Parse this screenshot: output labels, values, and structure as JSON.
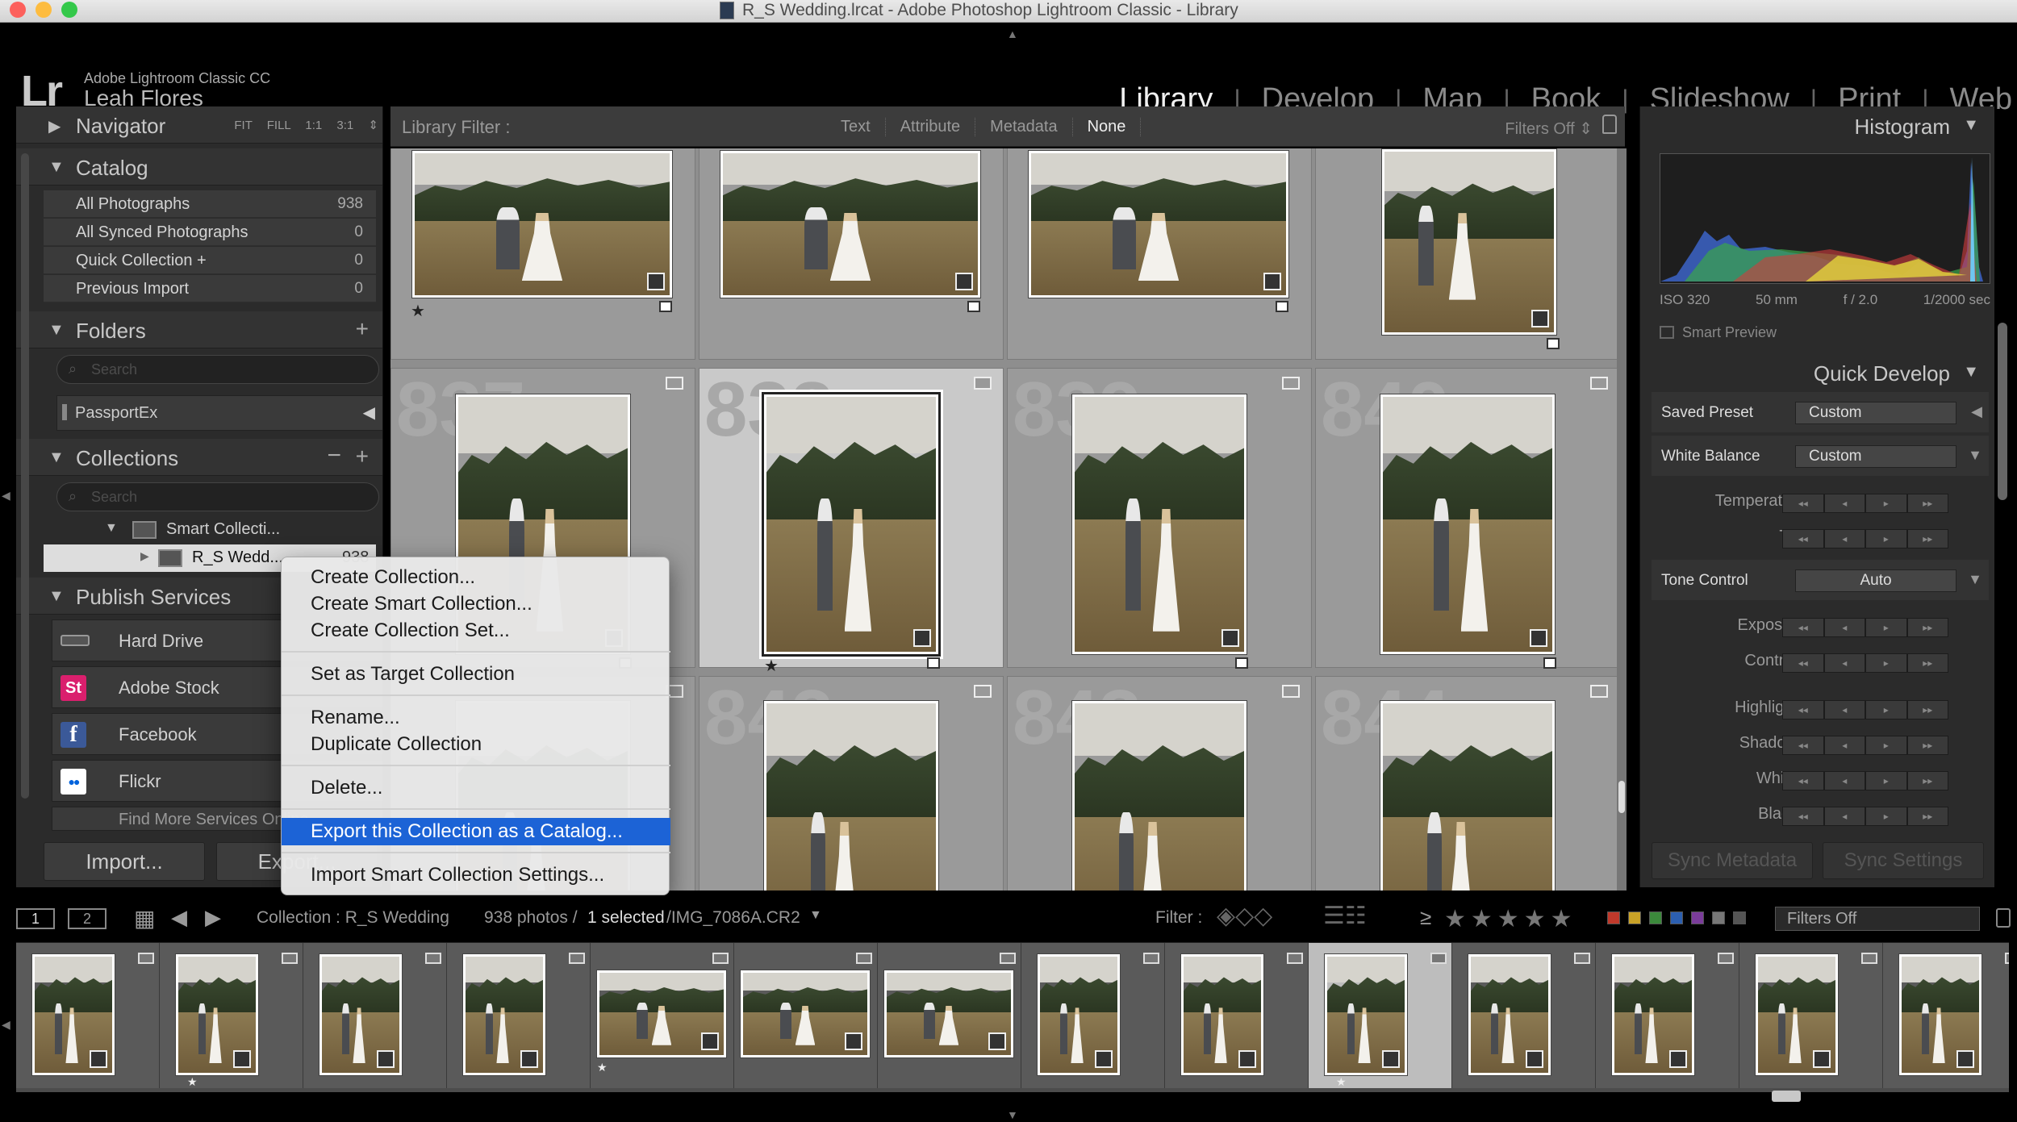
{
  "window": {
    "title": "R_S Wedding.lrcat - Adobe Photoshop Lightroom Classic - Library"
  },
  "identity": {
    "logo": "Lr",
    "product": "Adobe Lightroom Classic CC",
    "user": "Leah Flores"
  },
  "modules": [
    "Library",
    "Develop",
    "Map",
    "Book",
    "Slideshow",
    "Print",
    "Web"
  ],
  "left_panel": {
    "navigator": {
      "title": "Navigator",
      "options": "FIT FILL 1:1 3:1 ⇕"
    },
    "catalog": {
      "title": "Catalog",
      "items": [
        {
          "label": "All Photographs",
          "count": "938"
        },
        {
          "label": "All Synced Photographs",
          "count": "0"
        },
        {
          "label": "Quick Collection +",
          "count": "0"
        },
        {
          "label": "Previous Import",
          "count": "0"
        }
      ]
    },
    "folders": {
      "title": "Folders",
      "search_placeholder": "Search",
      "volume": "PassportEx"
    },
    "collections": {
      "title": "Collections",
      "search_placeholder": "Search",
      "set_label": "Smart Collecti...",
      "selected_label": "R_S Wedd...",
      "selected_count": "938"
    },
    "publish": {
      "title": "Publish Services",
      "services": [
        {
          "label": "Hard Drive",
          "icon": "hard-drive-icon",
          "color": "#555555",
          "glyph": ""
        },
        {
          "label": "Adobe Stock",
          "icon": "adobe-stock-icon",
          "color": "#da1f6d",
          "glyph": "St"
        },
        {
          "label": "Facebook",
          "icon": "facebook-icon",
          "color": "#3b5998",
          "glyph": "f"
        },
        {
          "label": "Flickr",
          "icon": "flickr-icon",
          "color": "#ffffff",
          "glyph": "●●"
        }
      ],
      "more": "Find More Services Online..."
    },
    "import_button": "Import...",
    "export_button": "Export..."
  },
  "library_filter": {
    "title": "Library Filter :",
    "options": [
      "Text",
      "Attribute",
      "Metadata",
      "None"
    ],
    "active": "None",
    "status": "Filters Off ⇕"
  },
  "grid": {
    "cells": [
      {
        "index": "",
        "star": "★",
        "selected": false,
        "orientation": "landscape"
      },
      {
        "index": "",
        "star": "",
        "selected": false,
        "orientation": "landscape"
      },
      {
        "index": "",
        "star": "",
        "selected": false,
        "orientation": "landscape"
      },
      {
        "index": "",
        "star": "",
        "selected": false,
        "orientation": "portrait"
      },
      {
        "index": "837",
        "star": "",
        "selected": false,
        "orientation": "portrait"
      },
      {
        "index": "838",
        "star": "★",
        "selected": true,
        "orientation": "portrait"
      },
      {
        "index": "839",
        "star": "",
        "selected": false,
        "orientation": "portrait"
      },
      {
        "index": "840",
        "star": "",
        "selected": false,
        "orientation": "portrait"
      },
      {
        "index": "841",
        "star": "",
        "selected": false,
        "orientation": "portrait"
      },
      {
        "index": "842",
        "star": "",
        "selected": false,
        "orientation": "portrait"
      },
      {
        "index": "843",
        "star": "",
        "selected": false,
        "orientation": "portrait"
      },
      {
        "index": "844",
        "star": "",
        "selected": false,
        "orientation": "portrait"
      }
    ]
  },
  "context_menu": {
    "items": [
      "Create Collection...",
      "Create Smart Collection...",
      "Create Collection Set...",
      "Set as Target Collection",
      "Rename...",
      "Duplicate Collection",
      "Delete...",
      "Export this Collection as a Catalog...",
      "Import Smart Collection Settings..."
    ],
    "highlighted": "Export this Collection as a Catalog..."
  },
  "right_panel": {
    "histogram": {
      "title": "Histogram",
      "iso": "ISO 320",
      "focal": "50 mm",
      "aperture": "f / 2.0",
      "shutter": "1/2000 sec",
      "smart_preview": "Smart Preview"
    },
    "quick_develop": {
      "title": "Quick Develop",
      "saved_preset_label": "Saved Preset",
      "saved_preset_value": "Custom",
      "white_balance_label": "White Balance",
      "white_balance_value": "Custom",
      "tone_control_label": "Tone Control",
      "auto_label": "Auto",
      "wb_adjustments": [
        "Temperature",
        "Tint"
      ],
      "tone_adjustments": [
        "Exposure",
        "Contrast"
      ],
      "tone_adjustments_2": [
        "Highlights",
        "Shadows",
        "Whites",
        "Blacks"
      ],
      "step_glyphs": [
        "◂◂",
        "◂",
        "▸",
        "▸▸"
      ]
    },
    "sync_metadata": "Sync Metadata",
    "sync_settings": "Sync Settings"
  },
  "filmstrip_bar": {
    "screen1": "1",
    "screen2": "2",
    "source": "Collection : R_S Wedding",
    "count": "938 photos /",
    "selected": "1 selected",
    "filename": "/IMG_7086A.CR2",
    "filter_label": "Filter :",
    "rating_op": "≥",
    "stars": "★★★★★",
    "filters_off": "Filters Off",
    "label_colors": [
      "#c0392b",
      "#c9a227",
      "#3c8a3c",
      "#2c5fb0",
      "#7a3c9a"
    ]
  },
  "filmstrip": {
    "thumbs": [
      {
        "orientation": "portrait",
        "star": "",
        "selected": false
      },
      {
        "orientation": "portrait",
        "star": "★",
        "selected": false
      },
      {
        "orientation": "portrait",
        "star": "",
        "selected": false
      },
      {
        "orientation": "portrait",
        "star": "",
        "selected": false
      },
      {
        "orientation": "landscape",
        "star": "★",
        "selected": false
      },
      {
        "orientation": "landscape",
        "star": "",
        "selected": false
      },
      {
        "orientation": "landscape",
        "star": "",
        "selected": false
      },
      {
        "orientation": "portrait",
        "star": "",
        "selected": false
      },
      {
        "orientation": "portrait",
        "star": "",
        "selected": false
      },
      {
        "orientation": "portrait",
        "star": "★",
        "selected": true
      },
      {
        "orientation": "portrait",
        "star": "",
        "selected": false
      },
      {
        "orientation": "portrait",
        "star": "",
        "selected": false
      },
      {
        "orientation": "portrait",
        "star": "",
        "selected": false
      },
      {
        "orientation": "portrait",
        "star": "",
        "selected": false
      }
    ]
  }
}
